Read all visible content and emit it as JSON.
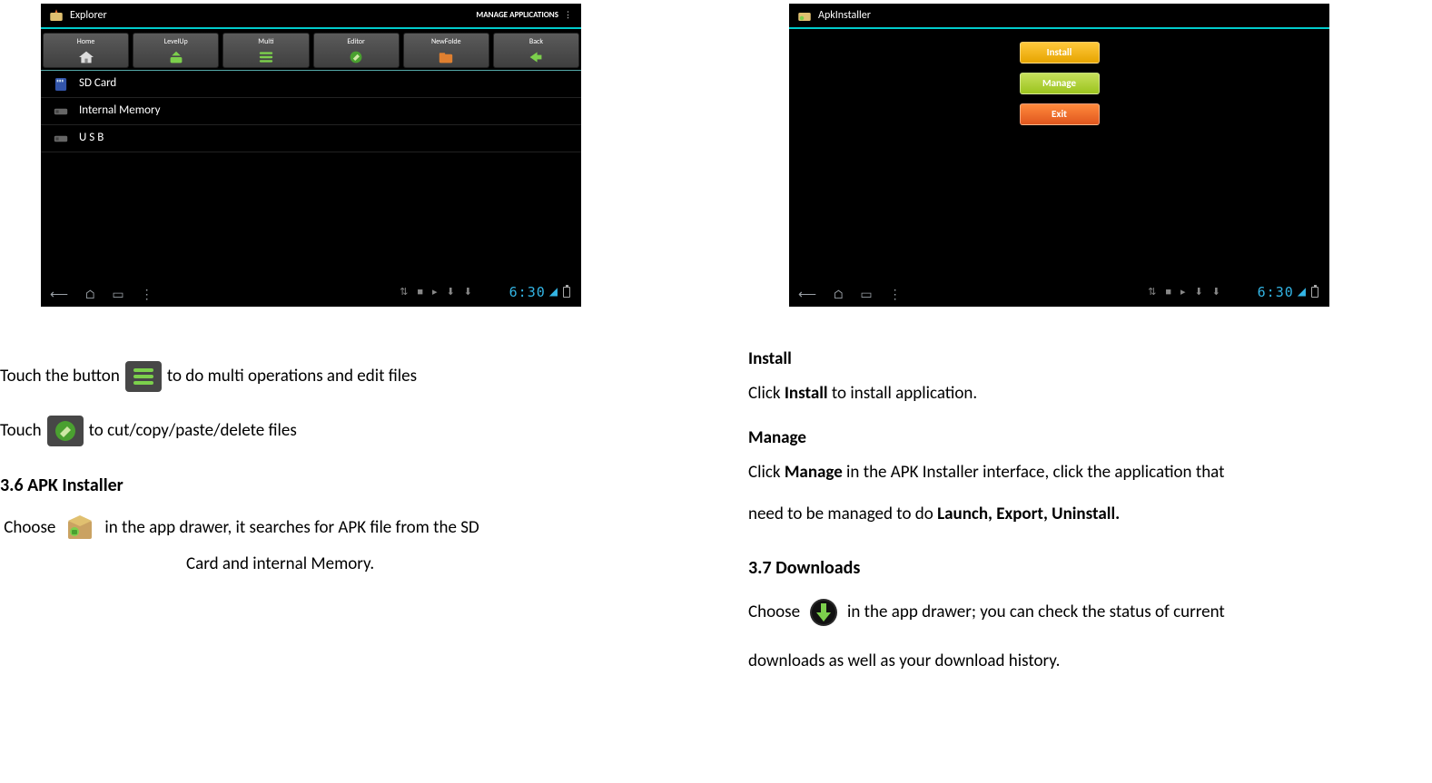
{
  "left": {
    "explorer": {
      "title": "Explorer",
      "manage": "MANAGE APPLICATIONS",
      "toolbar": [
        {
          "label": "Home",
          "icon": "home"
        },
        {
          "label": "LevelUp",
          "icon": "levelup"
        },
        {
          "label": "Multi",
          "icon": "multi"
        },
        {
          "label": "Editor",
          "icon": "editor"
        },
        {
          "label": "NewFolde",
          "icon": "newfolder"
        },
        {
          "label": "Back",
          "icon": "back"
        }
      ],
      "rows": [
        {
          "label": "SD Card",
          "icon": "sd"
        },
        {
          "label": "Internal Memory",
          "icon": "internal"
        },
        {
          "label": "U S B",
          "icon": "usb"
        }
      ],
      "clock": "6:30"
    },
    "text": {
      "multi_prefix": "Touch the button",
      "multi_suffix": "to do multi operations and edit files",
      "editor_prefix": "Touch",
      "editor_suffix": "to cut/copy/paste/delete files",
      "heading36": "3.6 APK Installer",
      "apk_prefix": "Choose",
      "apk_suffix": "in the app drawer, it searches for APK file from the SD",
      "apk_line2": "Card and internal Memory."
    }
  },
  "right": {
    "apkinstaller": {
      "title": "ApkInstaller",
      "install": "Install",
      "manage": "Manage",
      "exit": "Exit",
      "clock": "6:30"
    },
    "text": {
      "install_h": "Install",
      "install_body_pre": "Click ",
      "install_body_bold": "Install",
      "install_body_post": " to install application.",
      "manage_h": "Manage",
      "manage_body_pre": "Click ",
      "manage_body_bold": "Manage",
      "manage_body_mid": " in the APK Installer interface, click the application that",
      "manage_body2_pre": "need to be managed to do ",
      "manage_body2_bold": "Launch, Export, Uninstall.",
      "heading37": "3.7 Downloads",
      "dl_prefix": "Choose",
      "dl_suffix": "in the app drawer; you can check the status of current",
      "dl_line2": "downloads as well as your download history."
    }
  }
}
